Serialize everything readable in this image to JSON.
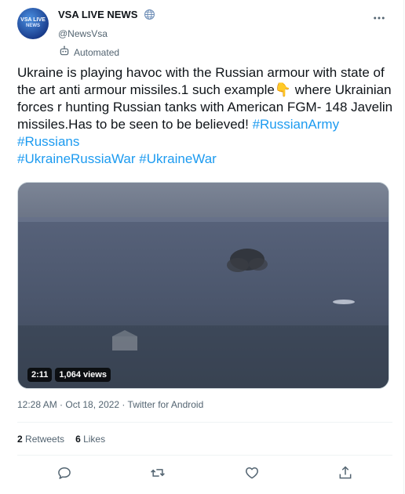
{
  "account": {
    "display_name": "VSA LIVE NEWS",
    "handle": "@NewsVsa",
    "automated_label": "Automated",
    "avatar_text_line1": "VSA LIVE",
    "avatar_text_line2": "NEWS"
  },
  "tweet": {
    "text": "Ukraine is playing havoc with the Russian armour with state of the art anti armour missiles.1 such example👇 where Ukrainian forces r hunting Russian tanks with American FGM- 148 Javelin missiles.Has to be seen to be believed! ",
    "hashtags": [
      "#RussianArmy",
      "#Russians",
      "#UkraineRussiaWar",
      "#UkraineWar"
    ]
  },
  "video": {
    "duration": "2:11",
    "views": "1,064 views"
  },
  "meta": {
    "time": "12:28 AM",
    "separator": " · ",
    "date": "Oct 18, 2022",
    "source": "Twitter for Android"
  },
  "stats": {
    "retweets_count": "2",
    "retweets_label": "Retweets",
    "likes_count": "6",
    "likes_label": "Likes"
  },
  "icons": {
    "verified": "globe-icon",
    "more": "more-icon",
    "automated": "robot-icon",
    "reply": "reply-icon",
    "retweet": "retweet-icon",
    "like": "heart-icon",
    "share": "share-icon"
  },
  "colors": {
    "link": "#1d9bf0",
    "secondary_text": "#536471",
    "primary_text": "#0f1419"
  }
}
